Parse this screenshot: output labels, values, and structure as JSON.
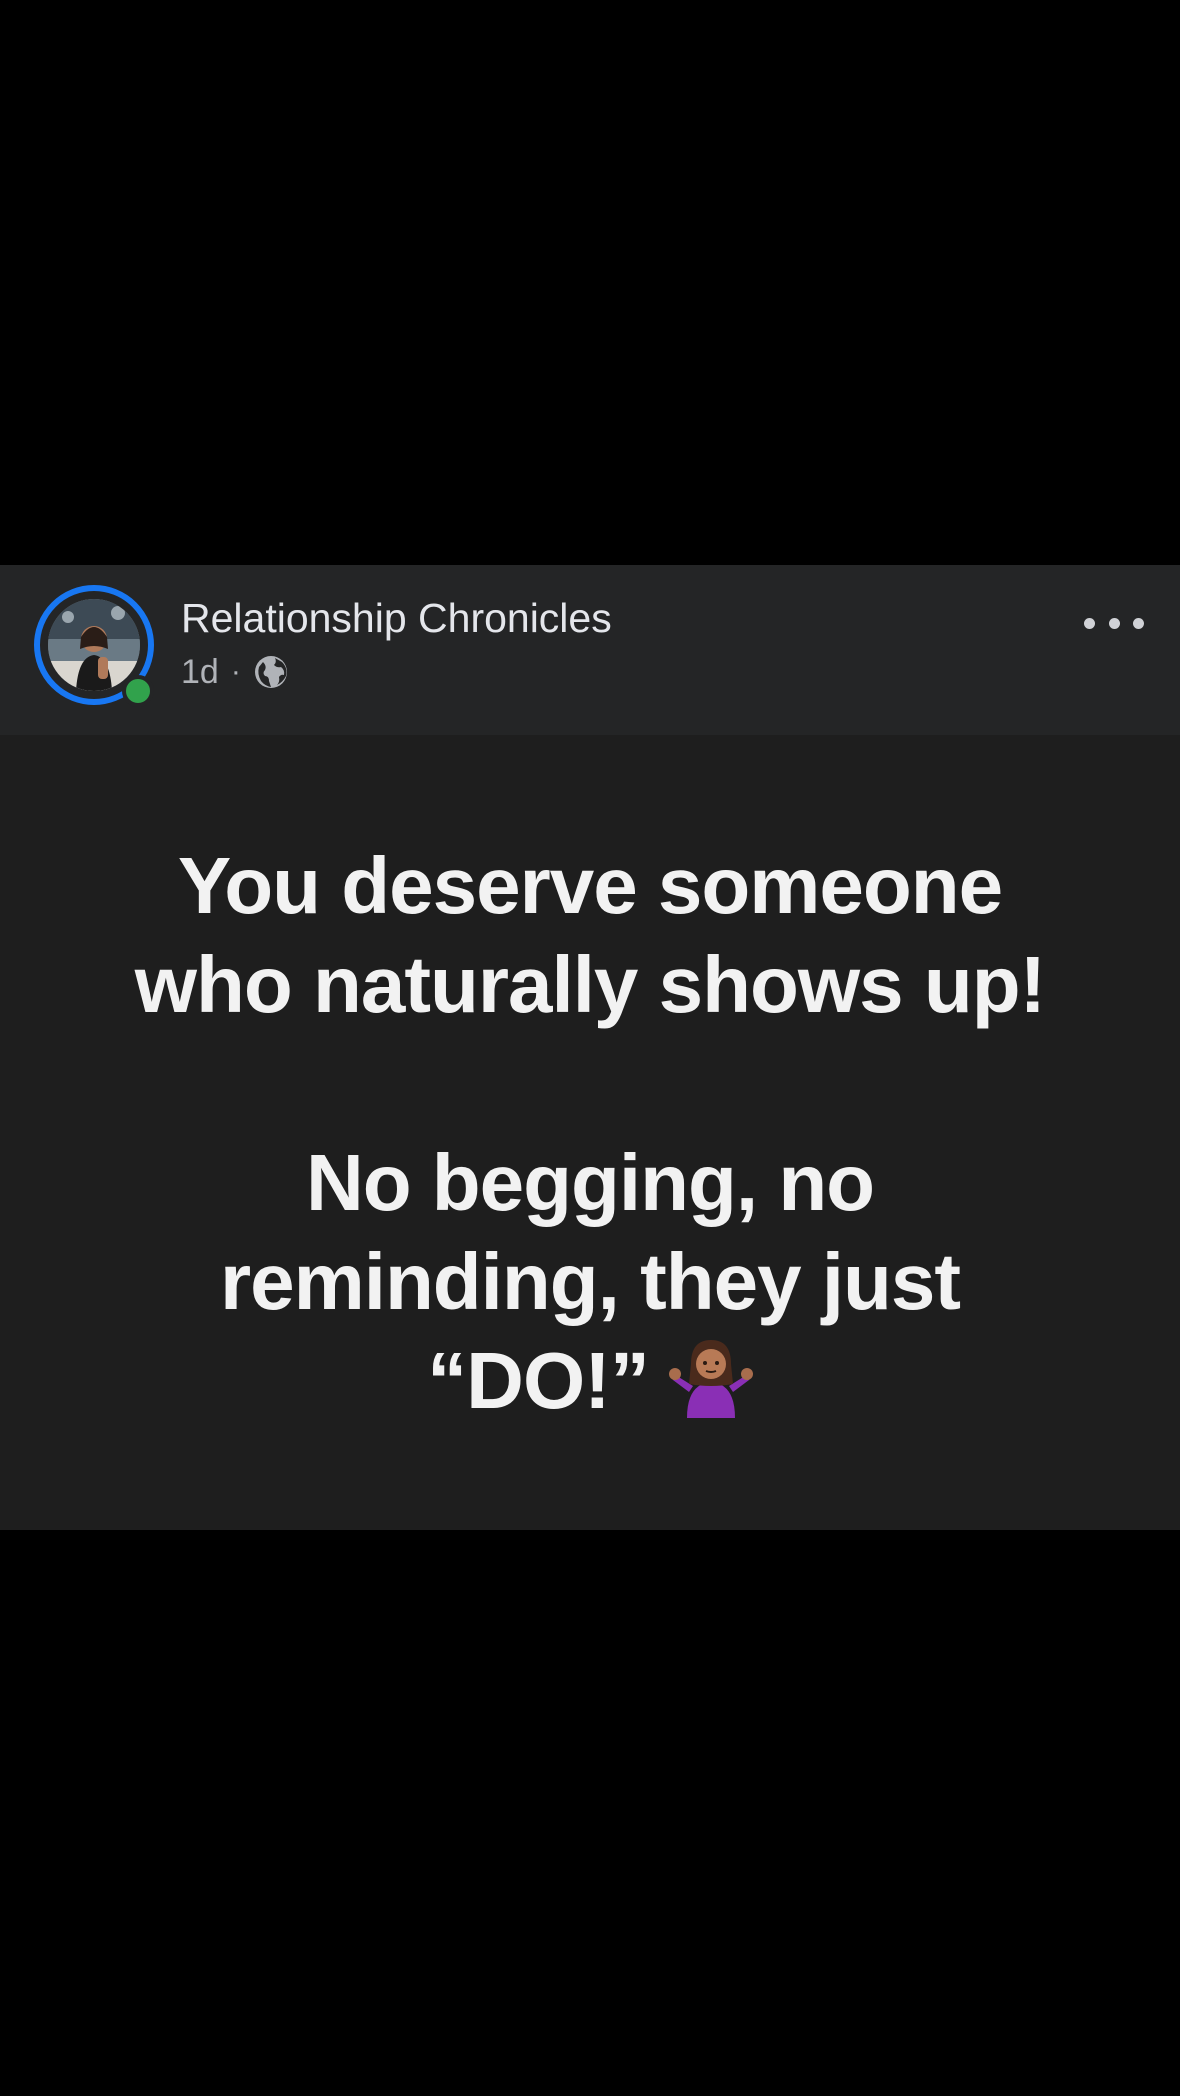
{
  "post": {
    "author": "Relationship Chronicles",
    "time": "1d",
    "separator": "·",
    "privacy_icon": "globe-icon",
    "menu_icon": "more-horizontal-icon",
    "text_lines_part1": [
      "You deserve someone",
      "who naturally shows up!"
    ],
    "text_lines_part2": [
      "No begging, no",
      "reminding, they just"
    ],
    "last_line": "“DO!”",
    "emoji": "person-shrugging-emoji"
  },
  "colors": {
    "header_bg": "#242526",
    "body_bg": "#1e1e1e",
    "avatar_ring": "#1877f2",
    "online_dot": "#31a24c",
    "text": "#f2f2f2"
  }
}
